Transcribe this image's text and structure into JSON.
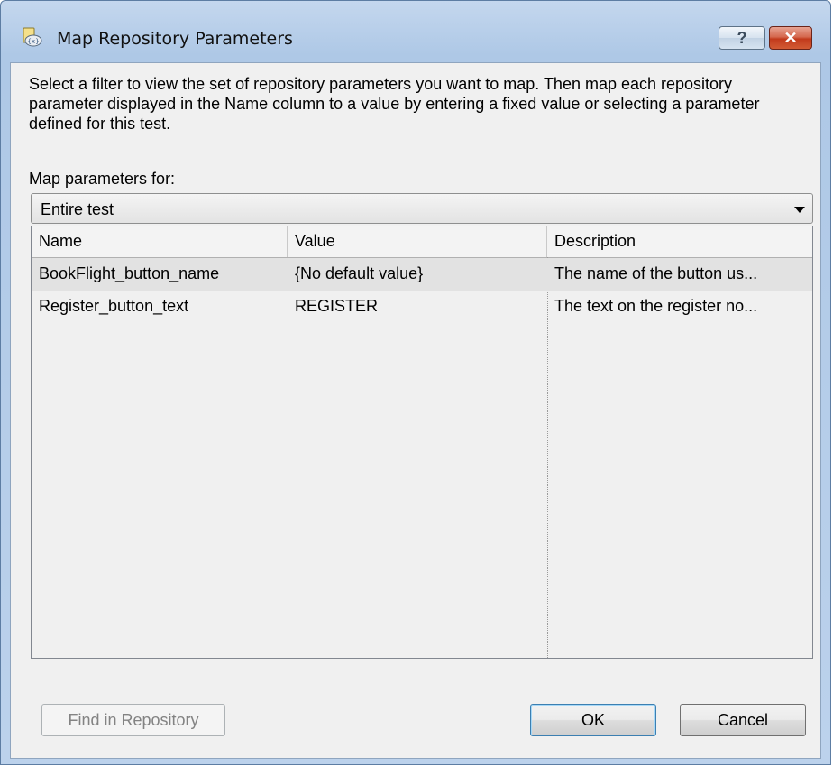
{
  "window": {
    "title": "Map Repository Parameters",
    "help_label": "?",
    "close_label": "✕"
  },
  "instructions": "Select a filter to view the set of repository parameters you want to map.  Then map each repository parameter displayed in the Name column to a value by entering a fixed value or selecting a parameter defined for this test.",
  "filter": {
    "label": "Map parameters for:",
    "selected": "Entire test"
  },
  "table": {
    "columns": [
      "Name",
      "Value",
      "Description"
    ],
    "rows": [
      {
        "name": "BookFlight_button_name",
        "value": "{No default value}",
        "description": "The name of the button us..."
      },
      {
        "name": "Register_button_text",
        "value": "REGISTER",
        "description": "The text on the register no..."
      }
    ]
  },
  "buttons": {
    "find": "Find in Repository",
    "ok": "OK",
    "cancel": "Cancel"
  },
  "colors": {
    "titlebar": "#aec8e6",
    "close": "#c23a1c",
    "dialog_bg": "#f0f0f0",
    "selected_row": "#e2e2e2"
  }
}
